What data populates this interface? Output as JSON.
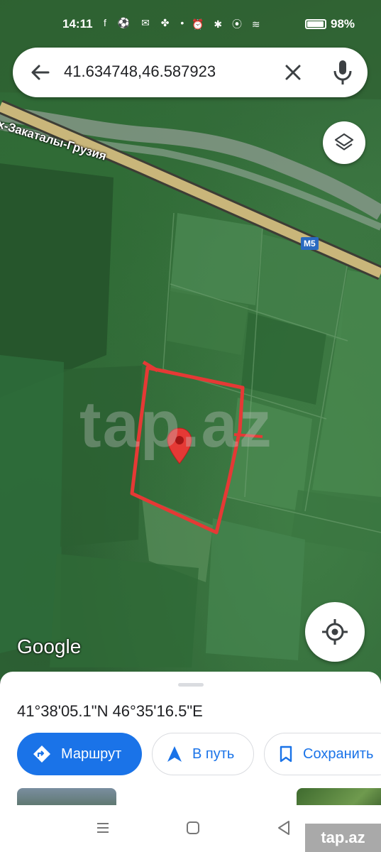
{
  "status_bar": {
    "time": "14:11",
    "notification_icons": "f ⚽ ✉ ✤ •",
    "system_icons": "⏰ ✱ ⦿ ≋",
    "battery_percent": "98%"
  },
  "search": {
    "query": "41.634748,46.587923",
    "icons": [
      "back-arrow-icon",
      "clear-icon",
      "mic-icon"
    ]
  },
  "map": {
    "road_label": "х-Закаталы-Грузия",
    "road_shield": "M5",
    "google_logo": "Google",
    "watermark": "tap.az",
    "icons": [
      "layers-icon",
      "my-location-icon",
      "location-pin-icon"
    ],
    "colors": {
      "boundary": "#e53935",
      "pin": "#e53935",
      "road": "#c9b67a"
    }
  },
  "place_sheet": {
    "coordinates": "41°38'05.1\"N 46°35'16.5\"E",
    "buttons": {
      "route": "Маршрут",
      "start": "В путь",
      "save": "Сохранить"
    },
    "accent_color": "#1a73e8"
  },
  "nav_bar": {
    "icons": [
      "menu-icon",
      "home-icon",
      "back-icon"
    ],
    "watermark": "tap.az"
  }
}
